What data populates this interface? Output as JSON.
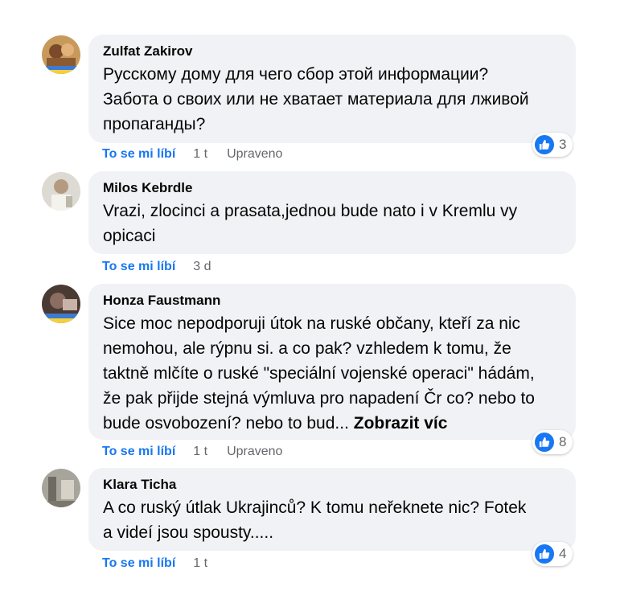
{
  "colors": {
    "accent": "#1877f2",
    "bubble": "#f0f2f5",
    "muted": "#65676b"
  },
  "comments": [
    {
      "author": "Zulfat Zakirov",
      "text": "Русскому дому для чего сбор этой информации?\nЗабота о своих или не хватает материала для лживой\nпропаганды?",
      "like_label": "To se mi líbí",
      "time": "1 t",
      "edited": "Upraveno",
      "reactions": "3",
      "reaction_icon": "like-icon"
    },
    {
      "author": "Milos Kebrdle",
      "text": "Vrazi, zlocinci a prasata,jednou bude nato i v Kremlu vy\nopicaci",
      "like_label": "To se mi líbí",
      "time": "3 d"
    },
    {
      "author": "Honza Faustmann",
      "text": "Sice moc nepodporuji útok na ruské občany, kteří za nic\nnemohou, ale rýpnu si. a co pak? vzhledem k tomu, že\ntaktně mlčíte o ruské \"speciální vojenské operaci\" hádám,\nže pak přijde stejná výmluva pro napadení Čr co? nebo to\nbude osvobození? nebo to bud... ",
      "see_more": "Zobrazit víc",
      "like_label": "To se mi líbí",
      "time": "1 t",
      "edited": "Upraveno",
      "reactions": "8",
      "reaction_icon": "like-icon"
    },
    {
      "author": "Klara Ticha",
      "text": "A co ruský útlak Ukrajinců? K tomu neřeknete nic? Fotek\na videí jsou spousty.....",
      "like_label": "To se mi líbí",
      "time": "1 t",
      "reactions": "4",
      "reaction_icon": "like-icon"
    }
  ]
}
